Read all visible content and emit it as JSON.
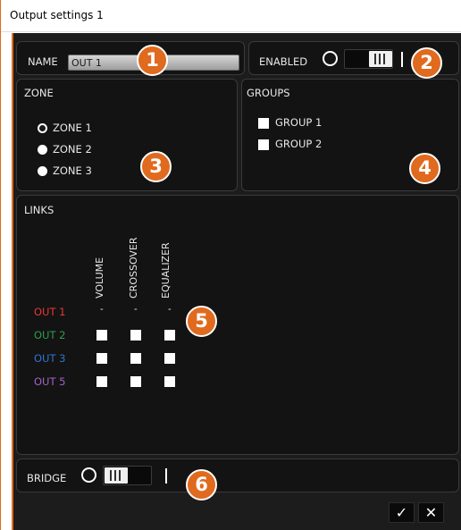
{
  "window": {
    "title": "Output settings 1"
  },
  "name": {
    "label": "NAME",
    "value": "OUT 1"
  },
  "enabled": {
    "label": "ENABLED",
    "on": true
  },
  "zone": {
    "title": "ZONE",
    "options": [
      "ZONE 1",
      "ZONE 2",
      "ZONE 3"
    ],
    "selected": "ZONE 1"
  },
  "groups": {
    "title": "GROUPS",
    "items": [
      {
        "label": "GROUP 1",
        "checked": false
      },
      {
        "label": "GROUP 2",
        "checked": false
      }
    ]
  },
  "links": {
    "title": "LINKS",
    "columns": [
      "VOLUME",
      "CROSSOVER",
      "EQUALIZER"
    ],
    "rows": [
      {
        "label": "OUT 1",
        "color": "#e53935",
        "cells": [
          "-",
          "-",
          "-"
        ]
      },
      {
        "label": "OUT 2",
        "color": "#2e9e4b",
        "cells": [
          "box",
          "box",
          "box"
        ]
      },
      {
        "label": "OUT 3",
        "color": "#2f74d0",
        "cells": [
          "box",
          "box",
          "box"
        ]
      },
      {
        "label": "OUT 5",
        "color": "#a163c7",
        "cells": [
          "box",
          "box",
          "box"
        ]
      }
    ]
  },
  "bridge": {
    "label": "BRIDGE",
    "on": false
  },
  "callouts": [
    "1",
    "2",
    "3",
    "4",
    "5",
    "6"
  ],
  "actions": {
    "confirm": "✓",
    "cancel": "✕"
  },
  "colors": {
    "accent": "#e06a1d",
    "panel": "#131313",
    "background": "#1c1c1c"
  }
}
